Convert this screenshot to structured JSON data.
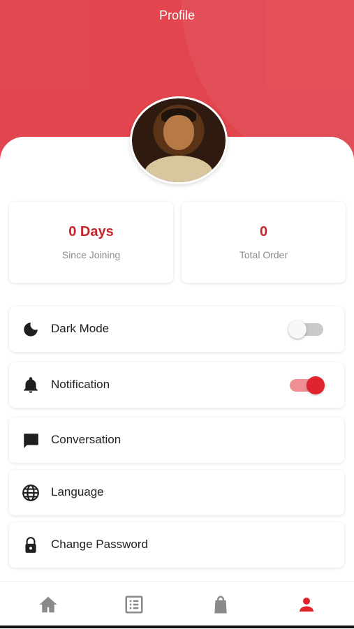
{
  "header": {
    "title": "Profile"
  },
  "stats": [
    {
      "value": "0 Days",
      "label": "Since Joining"
    },
    {
      "value": "0",
      "label": "Total Order"
    }
  ],
  "menu": [
    {
      "label": "Dark Mode",
      "icon": "moon-icon",
      "toggle": "off"
    },
    {
      "label": "Notification",
      "icon": "bell-icon",
      "toggle": "on"
    },
    {
      "label": "Conversation",
      "icon": "chat-icon"
    },
    {
      "label": "Language",
      "icon": "globe-icon"
    },
    {
      "label": "Change Password",
      "icon": "lock-icon"
    }
  ],
  "bottom_nav": [
    {
      "icon": "home-icon",
      "active": false
    },
    {
      "icon": "list-icon",
      "active": false
    },
    {
      "icon": "bag-icon",
      "active": false
    },
    {
      "icon": "profile-icon",
      "active": true
    }
  ],
  "colors": {
    "accent": "#e0232c",
    "header": "#e0363f",
    "stat_text": "#c6232d"
  }
}
